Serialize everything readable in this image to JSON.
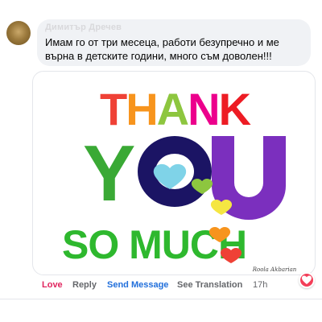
{
  "comment": {
    "author": "Димитър Дречев",
    "text": "Имам го от три месеца, работи безупречно и ме върна в детските години, много съм доволен!!!"
  },
  "gif": {
    "line1": "THANK",
    "line2": "YOU",
    "line3": "SO MUCH",
    "signature": "Roola Akbarian"
  },
  "actions": {
    "love": "Love",
    "reply": "Reply",
    "send_message": "Send Message",
    "see_translation": "See Translation",
    "time": "17h"
  },
  "reaction": {
    "icon": "heart-icon",
    "color": "#f33e58"
  }
}
